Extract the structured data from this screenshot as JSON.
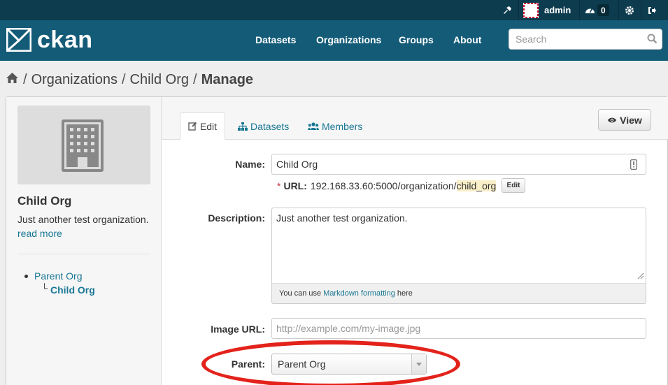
{
  "account": {
    "username": "admin",
    "dashboard_count": "0"
  },
  "masthead": {
    "logo_text": "ckan",
    "nav": [
      "Datasets",
      "Organizations",
      "Groups",
      "About"
    ],
    "search_placeholder": "Search"
  },
  "breadcrumb": {
    "sep": "/",
    "items": [
      "Organizations",
      "Child Org"
    ],
    "active": "Manage"
  },
  "sidebar": {
    "org_name": "Child Org",
    "description": "Just another test organization.",
    "read_more": "read more",
    "hierarchy": {
      "parent": "Parent Org",
      "child": "Child Org",
      "elbow": "└"
    }
  },
  "tabs": {
    "edit": "Edit",
    "datasets": "Datasets",
    "members": "Members"
  },
  "view_button": "View",
  "form": {
    "name_label": "Name:",
    "name_value": "Child Org",
    "url_star": "*",
    "url_label": "URL:",
    "url_prefix": "192.168.33.60:5000/organization/",
    "url_slug": "child_org",
    "url_edit": "Edit",
    "description_label": "Description:",
    "description_value": "Just another test organization.",
    "markdown_before": "You can use",
    "markdown_link": "Markdown formatting",
    "markdown_after": "here",
    "image_url_label": "Image URL:",
    "image_url_placeholder": "http://example.com/my-image.jpg",
    "parent_label": "Parent:",
    "parent_value": "Parent Org"
  },
  "colors": {
    "masthead": "#145b78",
    "account_bar": "#0d3c4f",
    "link": "#187794",
    "highlight": "#e3231b"
  }
}
